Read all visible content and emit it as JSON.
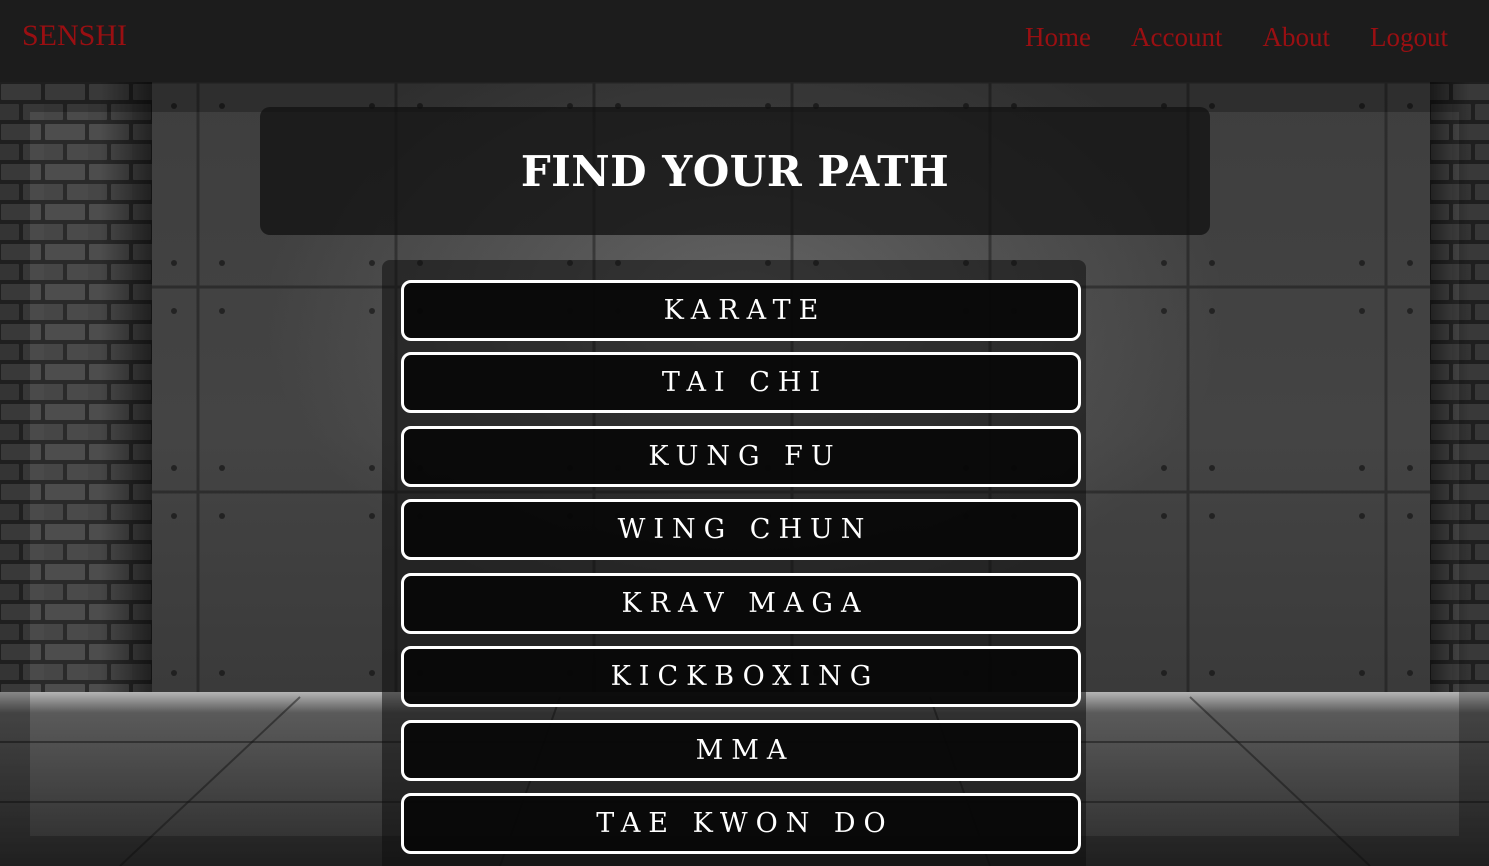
{
  "nav": {
    "brand": "SENSHI",
    "links": [
      "Home",
      "Account",
      "About",
      "Logout"
    ]
  },
  "main": {
    "title": "FIND YOUR PATH",
    "styles": [
      "KARATE",
      "TAI CHI",
      "KUNG FU",
      "WING CHUN",
      "KRAV MAGA",
      "KICKBOXING",
      "MMA",
      "TAE KWON DO"
    ]
  },
  "colors": {
    "brand_red": "#9a0f12",
    "nav_background": "#1c1c1c",
    "button_border": "#ffffff",
    "button_background": "#080808"
  }
}
